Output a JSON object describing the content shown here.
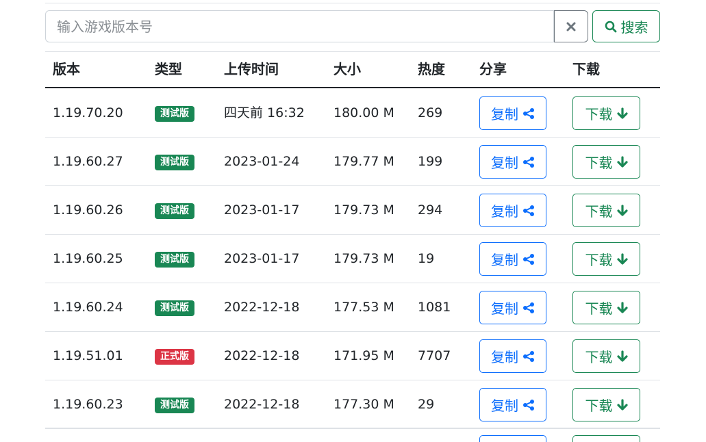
{
  "search": {
    "placeholder": "输入游戏版本号",
    "clear_icon": "times-icon",
    "button_label": "搜索",
    "button_icon": "search-icon"
  },
  "table": {
    "headers": [
      "版本",
      "类型",
      "上传时间",
      "大小",
      "热度",
      "分享",
      "下载"
    ],
    "rows": [
      {
        "version": "1.19.70.20",
        "type": "测试版",
        "type_color": "#198754",
        "time": "四天前 16:32",
        "size": "180.00 M",
        "heat": "269",
        "copy_label": "复制",
        "download_label": "下载"
      },
      {
        "version": "1.19.60.27",
        "type": "测试版",
        "type_color": "#198754",
        "time": "2023-01-24",
        "size": "179.77 M",
        "heat": "199",
        "copy_label": "复制",
        "download_label": "下载"
      },
      {
        "version": "1.19.60.26",
        "type": "测试版",
        "type_color": "#198754",
        "time": "2023-01-17",
        "size": "179.73 M",
        "heat": "294",
        "copy_label": "复制",
        "download_label": "下载"
      },
      {
        "version": "1.19.60.25",
        "type": "测试版",
        "type_color": "#198754",
        "time": "2023-01-17",
        "size": "179.73 M",
        "heat": "19",
        "copy_label": "复制",
        "download_label": "下载"
      },
      {
        "version": "1.19.60.24",
        "type": "测试版",
        "type_color": "#198754",
        "time": "2022-12-18",
        "size": "177.53 M",
        "heat": "1081",
        "copy_label": "复制",
        "download_label": "下载"
      },
      {
        "version": "1.19.51.01",
        "type": "正式版",
        "type_color": "#dc3545",
        "time": "2022-12-18",
        "size": "171.95 M",
        "heat": "7707",
        "copy_label": "复制",
        "download_label": "下载"
      },
      {
        "version": "1.19.60.23",
        "type": "测试版",
        "type_color": "#198754",
        "time": "2022-12-18",
        "size": "177.30 M",
        "heat": "29",
        "copy_label": "复制",
        "download_label": "下载"
      }
    ]
  },
  "colors": {
    "primary": "#0d6efd",
    "success": "#198754",
    "danger": "#dc3545"
  }
}
